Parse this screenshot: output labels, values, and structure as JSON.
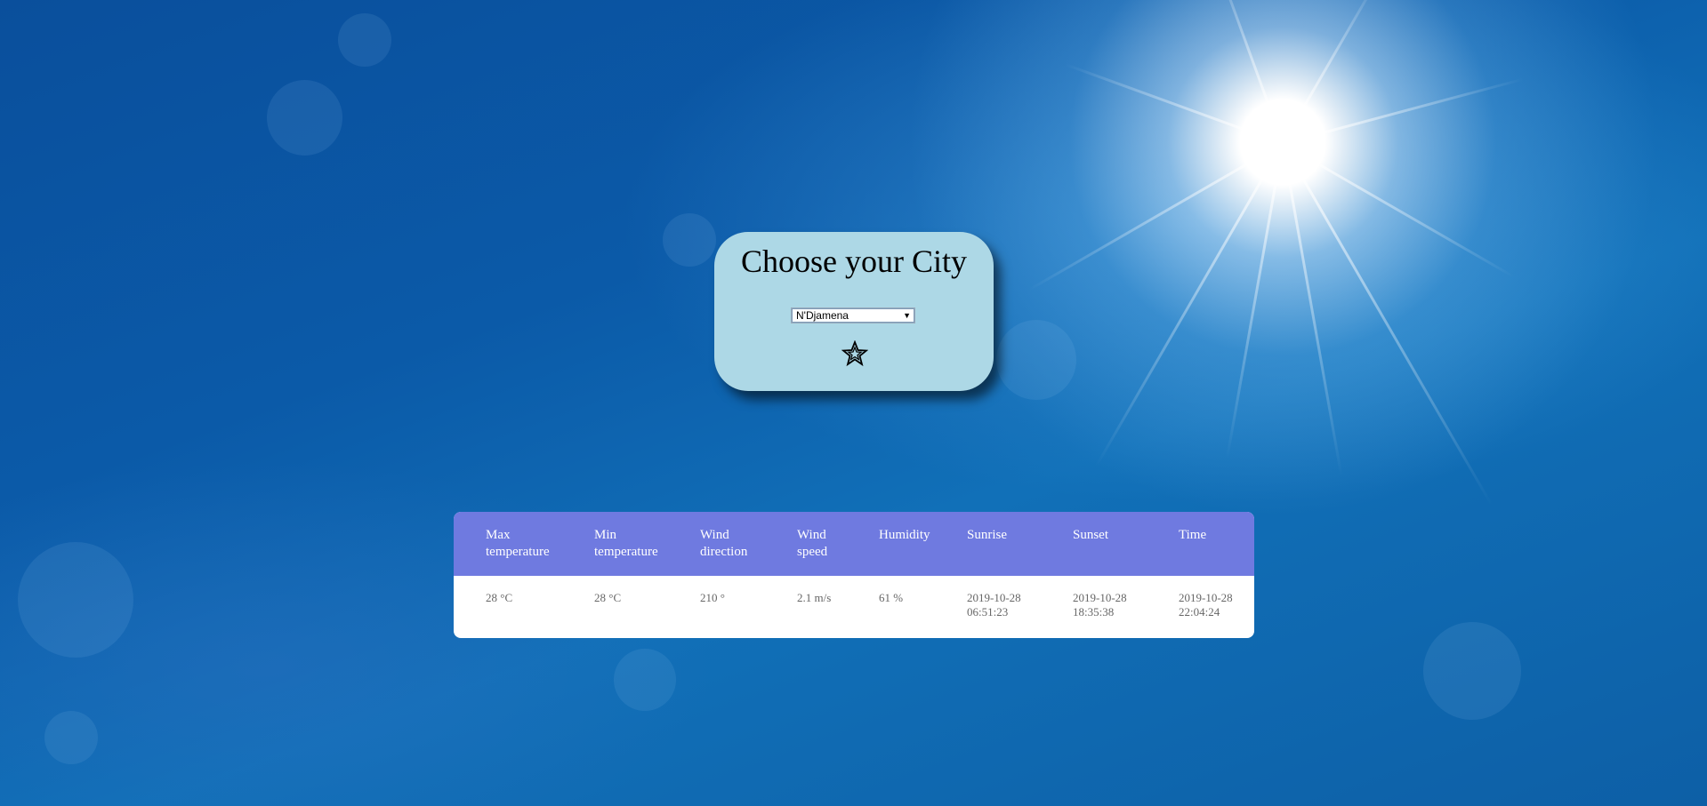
{
  "page": {
    "title": "Choose your City"
  },
  "city_select": {
    "selected": "N'Djamena",
    "arrow_icon": "triangle-down-icon"
  },
  "favorite": {
    "icon": "star-icon"
  },
  "weather_table": {
    "headers": [
      "Max temperature",
      "Min temperature",
      "Wind direction",
      "Wind speed",
      "Humidity",
      "Sunrise",
      "Sunset",
      "Time"
    ],
    "row": [
      "28 °C",
      "28 °C",
      "210 °",
      "2.1 m/s",
      "61 %",
      "2019-10-28 06:51:23",
      "2019-10-28 18:35:38",
      "2019-10-28 22:04:24"
    ]
  },
  "colors": {
    "card_background": "#add8e6",
    "table_header": "#6f7ae0",
    "sky": "#0b5aa8"
  }
}
